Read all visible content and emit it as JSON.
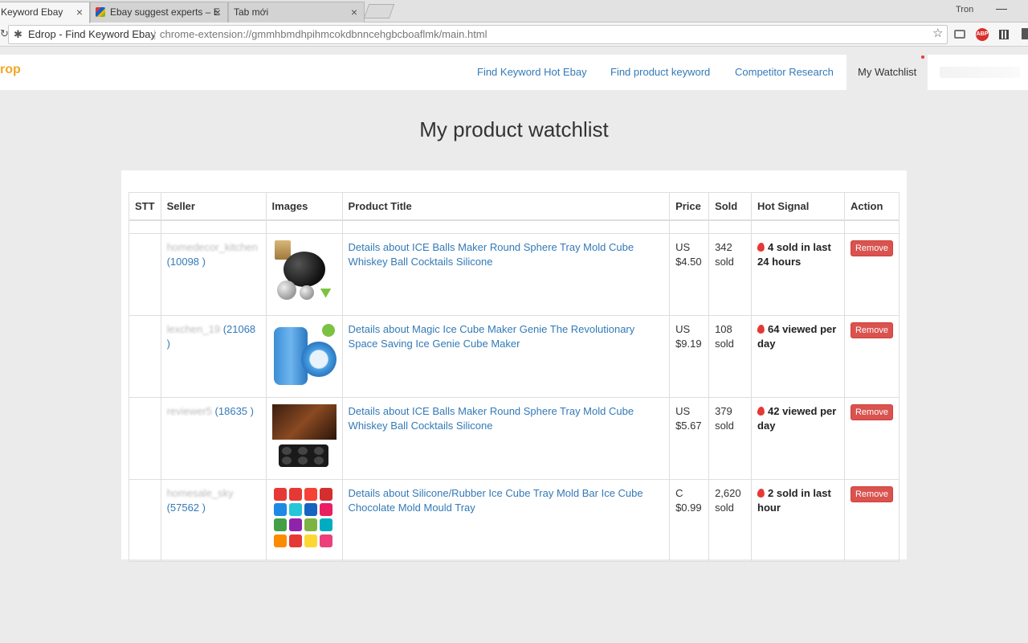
{
  "browser": {
    "tabs": [
      {
        "title": "Keyword Ebay"
      },
      {
        "title": "Ebay suggest experts – E"
      },
      {
        "title": "Tab mới"
      }
    ],
    "user": "Tron",
    "page_title": "Edrop - Find Keyword Ebay",
    "url": "chrome-extension://gmmhbmdhpihmcokdbnncehgbcboaflmk/main.html",
    "extension_icons": [
      "camera-icon",
      "adblock-plus-icon",
      "qr-code-icon"
    ]
  },
  "app": {
    "brand": "rop",
    "brand_color": "#f5a623",
    "nav": [
      {
        "label": "Find Keyword Hot Ebay"
      },
      {
        "label": "Find product keyword"
      },
      {
        "label": "Competitor Research"
      },
      {
        "label": "My Watchlist",
        "active": true
      }
    ]
  },
  "main": {
    "title": "My product watchlist",
    "columns": [
      "STT",
      "Seller",
      "Images",
      "Product Title",
      "Price",
      "Sold",
      "Hot Signal",
      "Action"
    ],
    "rows": [
      {
        "stt": "",
        "seller": "homedecor_kitchen",
        "seller_count": "(10098 )",
        "title": "Details about  ICE Balls Maker Round Sphere Tray Mold Cube Whiskey Ball Cocktails Silicone",
        "price_cur": "US",
        "price": "$4.50",
        "sold": "342",
        "sold_unit": "sold",
        "hot": "4 sold in last 24 hours",
        "action": "Remove"
      },
      {
        "stt": "",
        "seller": "lexchen_19",
        "seller_count": "(21068 )",
        "title": "Details about  Magic Ice Cube Maker Genie The Revolutionary Space Saving Ice Genie Cube Maker",
        "price_cur": "US",
        "price": "$9.19",
        "sold": "108",
        "sold_unit": "sold",
        "hot": "64 viewed per day",
        "action": "Remove"
      },
      {
        "stt": "",
        "seller": "reviewer5",
        "seller_count": "(18635 )",
        "title": "Details about  ICE Balls Maker Round Sphere Tray Mold Cube Whiskey Ball Cocktails Silicone",
        "price_cur": "US",
        "price": "$5.67",
        "sold": "379",
        "sold_unit": "sold",
        "hot": "42 viewed per day",
        "action": "Remove"
      },
      {
        "stt": "",
        "seller": "homesale_sky",
        "seller_count": "(57562 )",
        "title": "Details about  Silicone/Rubber Ice Cube Tray Mold Bar Ice Cube Chocolate Mold Mould Tray",
        "price_cur": "C",
        "price": "$0.99",
        "sold": "2,620",
        "sold_unit": "sold",
        "hot": "2 sold in last hour",
        "action": "Remove"
      }
    ]
  },
  "colors": {
    "link": "#337ab7",
    "remove": "#d9534f",
    "fire": "#e53935"
  }
}
